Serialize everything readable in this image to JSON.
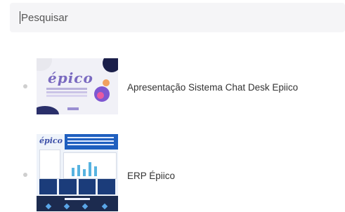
{
  "search": {
    "placeholder": "Pesquisar",
    "value": ""
  },
  "items": [
    {
      "title": "Apresentação Sistema Chat Desk Epiico",
      "thumb_logo": "épico"
    },
    {
      "title": "ERP Épiico",
      "thumb_logo": "épico"
    }
  ],
  "colors": {
    "background": "#ffffff",
    "search_bg": "#f5f5f7",
    "bullet": "#cfcfcf",
    "text": "#333333"
  }
}
